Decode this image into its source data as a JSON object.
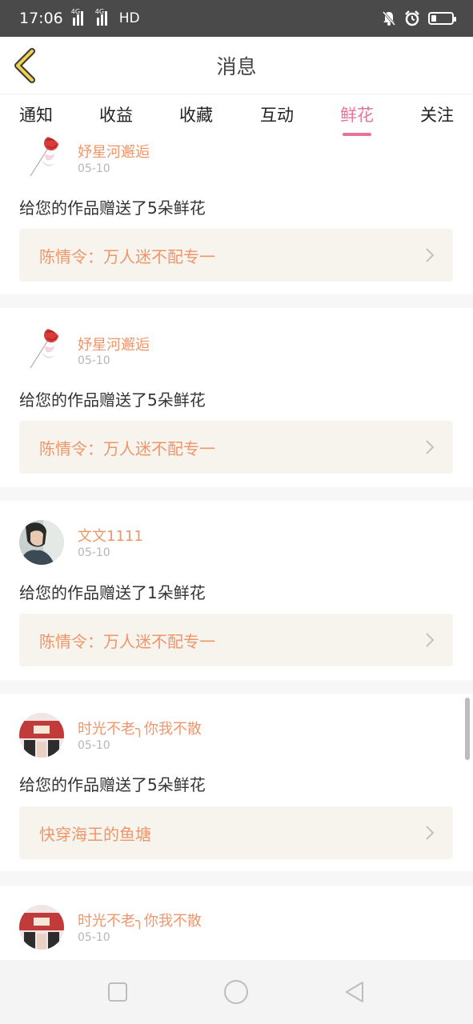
{
  "status_bar": {
    "time": "17:06",
    "signal1_label": "4G",
    "signal2_label": "4G",
    "hd": "HD",
    "icons": [
      "signal-icon",
      "signal-icon",
      "notification-off-icon",
      "alarm-icon",
      "battery-icon"
    ]
  },
  "header": {
    "title": "消息",
    "back_icon": "back-chevron-icon"
  },
  "tabs": [
    {
      "label": "通知",
      "active": false
    },
    {
      "label": "收益",
      "active": false
    },
    {
      "label": "收藏",
      "active": false
    },
    {
      "label": "互动",
      "active": false
    },
    {
      "label": "鲜花",
      "active": true
    },
    {
      "label": "关注",
      "active": false
    }
  ],
  "messages": [
    {
      "user": "妤星河邂逅",
      "date": "05-10",
      "text": "给您的作品赠送了5朵鲜花",
      "work": "陈情令：万人迷不配专一",
      "avatar": "rose-avatar"
    },
    {
      "user": "妤星河邂逅",
      "date": "05-10",
      "text": "给您的作品赠送了5朵鲜花",
      "work": "陈情令：万人迷不配专一",
      "avatar": "rose-avatar"
    },
    {
      "user": "文文1111",
      "date": "05-10",
      "text": "给您的作品赠送了1朵鲜花",
      "work": "陈情令：万人迷不配专一",
      "avatar": "person-avatar"
    },
    {
      "user": "时光不老╮你我不散",
      "date": "05-10",
      "text": "给您的作品赠送了5朵鲜花",
      "work": "快穿海王的鱼塘",
      "avatar": "red-photo-avatar"
    },
    {
      "user": "时光不老╮你我不散",
      "date": "05-10",
      "text": "",
      "work": "",
      "avatar": "red-photo-avatar"
    }
  ],
  "bottom_nav": [
    "square-icon",
    "circle-icon",
    "triangle-back-icon"
  ],
  "colors": {
    "accent": "#e8739a",
    "username": "#f0956a",
    "status_bar": "#4a4a4a",
    "link_bg": "#f6f4ec"
  }
}
